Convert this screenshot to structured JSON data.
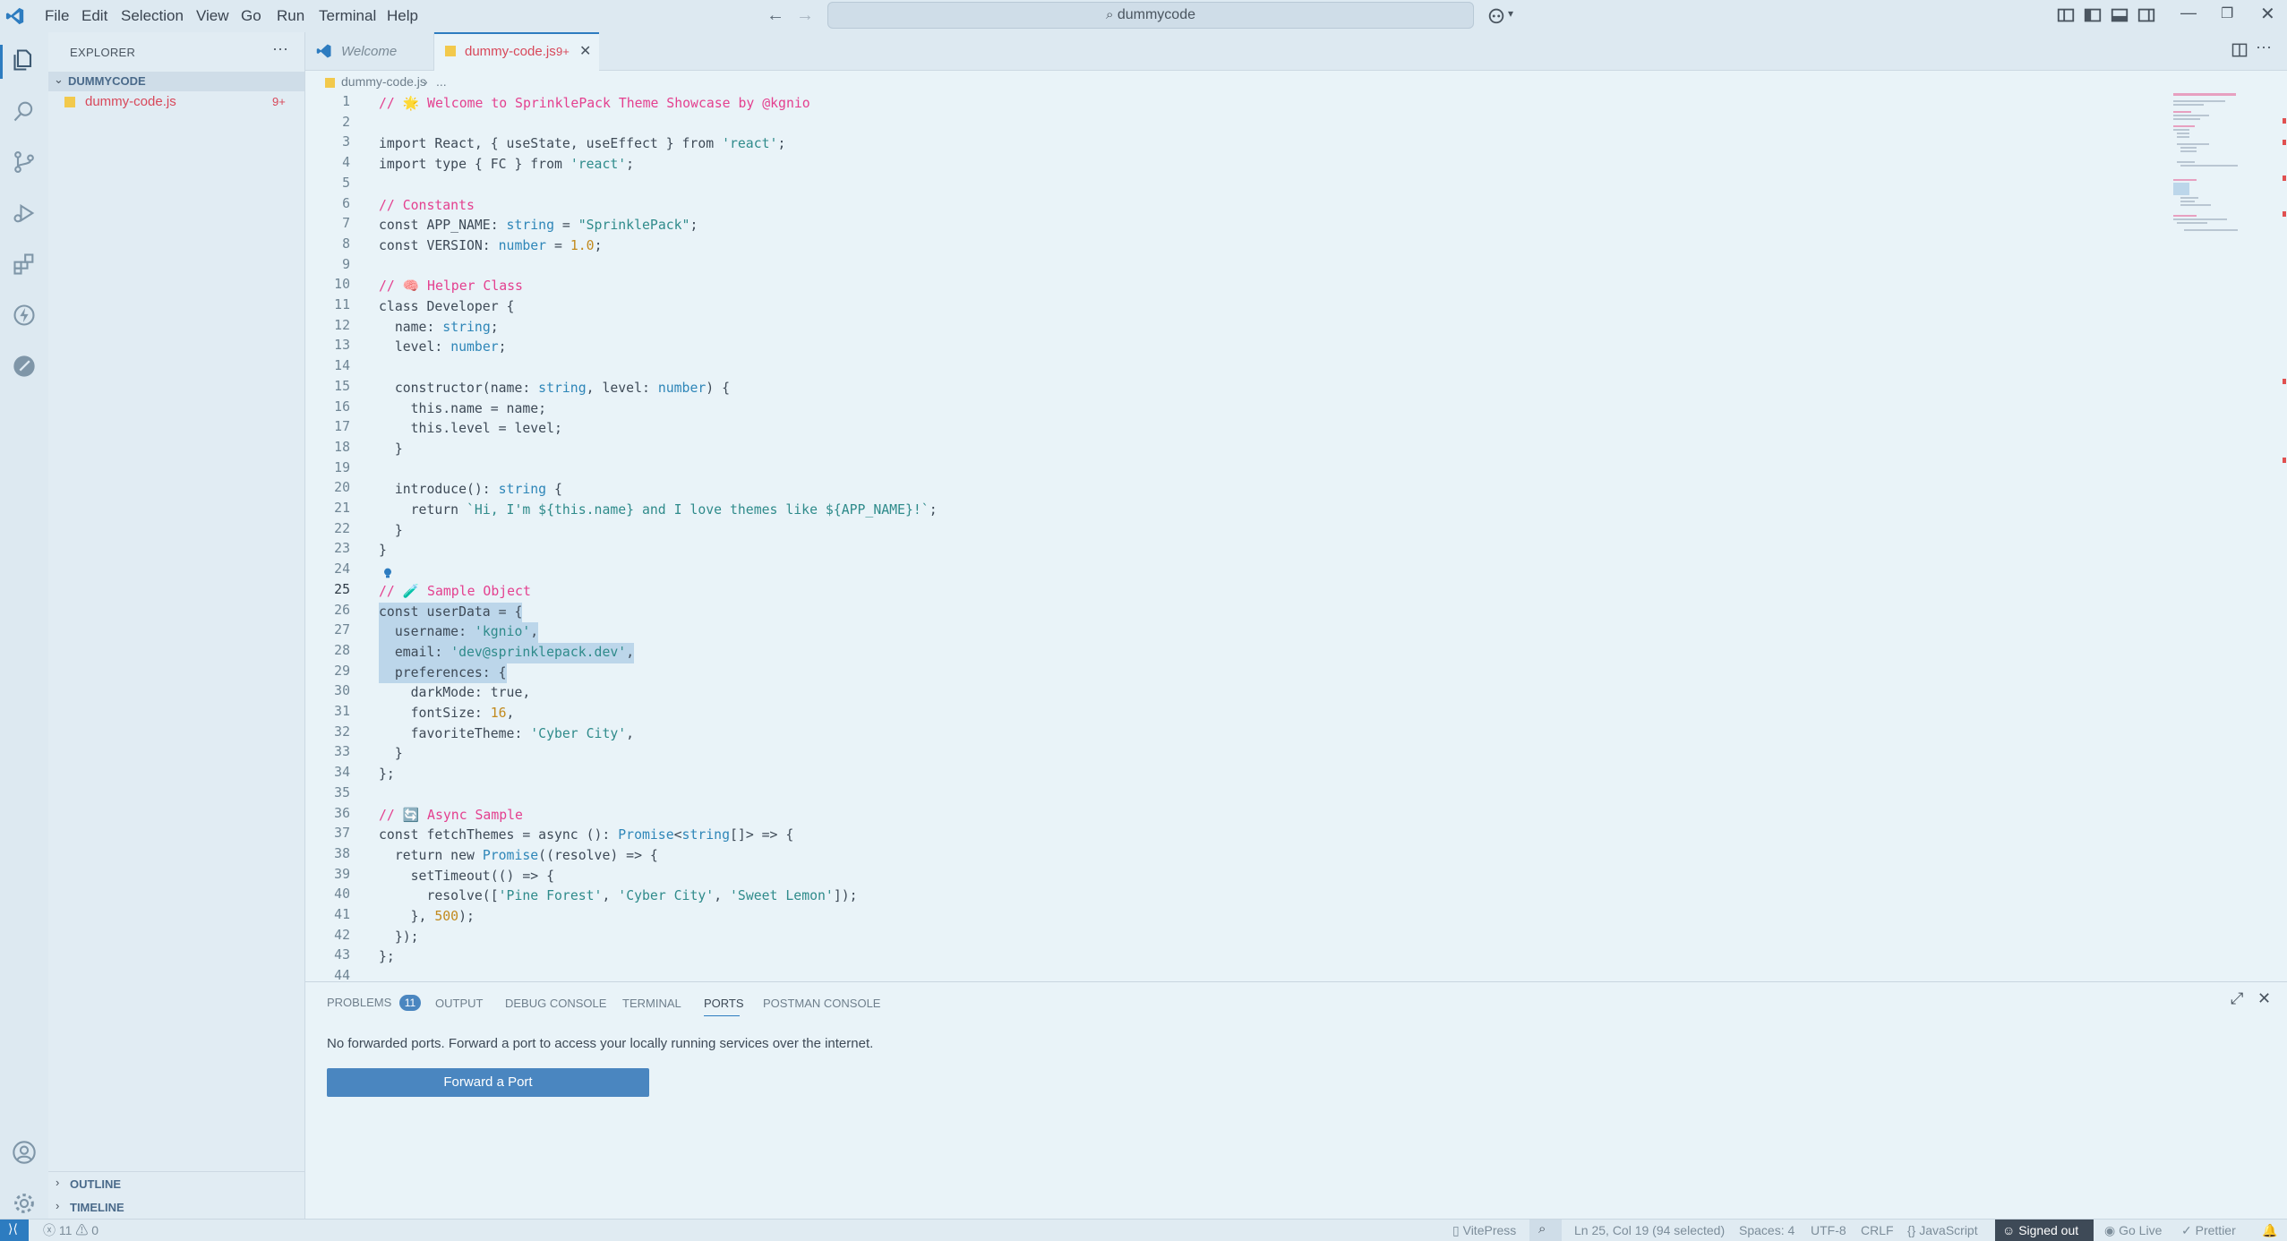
{
  "window": {
    "menu": [
      "File",
      "Edit",
      "Selection",
      "View",
      "Go",
      "Run",
      "Terminal",
      "Help"
    ],
    "search": "dummycode"
  },
  "sidebar": {
    "title": "EXPLORER",
    "folder": "DUMMYCODE",
    "file": "dummy-code.js",
    "file_badge": "9+",
    "outline": "OUTLINE",
    "timeline": "TIMELINE"
  },
  "tabs": [
    {
      "label": "Welcome"
    },
    {
      "label": "dummy-code.js",
      "badge": "9+"
    }
  ],
  "breadcrumb": {
    "file": "dummy-code.js",
    "rest": "..."
  },
  "code": {
    "line_numbers": [
      "1",
      "2",
      "3",
      "4",
      "5",
      "6",
      "7",
      "8",
      "9",
      "10",
      "11",
      "12",
      "13",
      "14",
      "15",
      "16",
      "17",
      "18",
      "19",
      "20",
      "21",
      "22",
      "23",
      "24",
      "25",
      "26",
      "27",
      "28",
      "29",
      "30",
      "31",
      "32",
      "33",
      "34",
      "35",
      "36",
      "37",
      "38",
      "39",
      "40",
      "41",
      "42",
      "43",
      "44"
    ],
    "lines": [
      "// 🌟 Welcome to SprinklePack Theme Showcase by @kgnio",
      "",
      "import React, { useState, useEffect } from 'react';",
      "import type { FC } from 'react';",
      "",
      "// Constants",
      "const APP_NAME: string = \"SprinklePack\";",
      "const VERSION: number = 1.0;",
      "",
      "// 🧠 Helper Class",
      "class Developer {",
      "  name: string;",
      "  level: number;",
      "",
      "  constructor(name: string, level: number) {",
      "    this.name = name;",
      "    this.level = level;",
      "  }",
      "",
      "  introduce(): string {",
      "    return `Hi, I'm ${this.name} and I love themes like ${APP_NAME}!`;",
      "  }",
      "}",
      "",
      "// 🧪 Sample Object",
      "const userData = {",
      "  username: 'kgnio',",
      "  email: 'dev@sprinklepack.dev',",
      "  preferences: {",
      "    darkMode: true,",
      "    fontSize: 16,",
      "    favoriteTheme: 'Cyber City',",
      "  }",
      "};",
      "",
      "// 🔄 Async Sample",
      "const fetchThemes = async (): Promise<string[]> => {",
      "  return new Promise((resolve) => {",
      "    setTimeout(() => {",
      "      resolve(['Pine Forest', 'Cyber City', 'Sweet Lemon']);",
      "    }, 500);",
      "  });",
      "};",
      ""
    ]
  },
  "panel": {
    "tabs": [
      {
        "label": "PROBLEMS",
        "badge": "11"
      },
      {
        "label": "OUTPUT"
      },
      {
        "label": "DEBUG CONSOLE"
      },
      {
        "label": "TERMINAL"
      },
      {
        "label": "PORTS"
      },
      {
        "label": "POSTMAN CONSOLE"
      }
    ],
    "message": "No forwarded ports. Forward a port to access your locally running services over the internet.",
    "button": "Forward a Port"
  },
  "status": {
    "problems": "11",
    "warnings": "0",
    "vitepress": "VitePress",
    "position": "Ln 25, Col 19 (94 selected)",
    "spaces": "Spaces: 4",
    "encoding": "UTF-8",
    "eol": "CRLF",
    "language": "JavaScript",
    "account": "Signed out",
    "golive": "Go Live",
    "prettier": "Prettier"
  },
  "colors": {
    "accent": "#4a86c0",
    "comment": "#e4408f",
    "error": "#e05050"
  }
}
